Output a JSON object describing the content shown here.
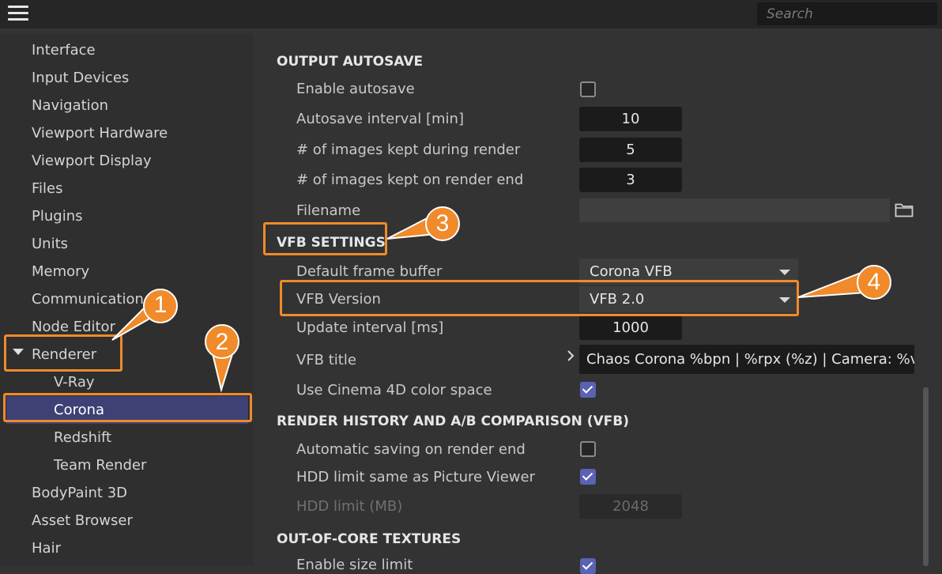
{
  "header": {
    "search_placeholder": "Search"
  },
  "sidebar": {
    "items": [
      {
        "label": "Interface"
      },
      {
        "label": "Input Devices"
      },
      {
        "label": "Navigation"
      },
      {
        "label": "Viewport Hardware"
      },
      {
        "label": "Viewport Display"
      },
      {
        "label": "Files"
      },
      {
        "label": "Plugins"
      },
      {
        "label": "Units"
      },
      {
        "label": "Memory"
      },
      {
        "label": "Communication"
      },
      {
        "label": "Node Editor"
      },
      {
        "label": "Renderer",
        "expanded": true
      },
      {
        "label": "V-Ray"
      },
      {
        "label": "Corona",
        "selected": true
      },
      {
        "label": "Redshift"
      },
      {
        "label": "Team Render"
      },
      {
        "label": "BodyPaint 3D"
      },
      {
        "label": "Asset Browser"
      },
      {
        "label": "Hair"
      }
    ]
  },
  "output_autosave": {
    "title": "OUTPUT AUTOSAVE",
    "enable_autosave_label": "Enable autosave",
    "enable_autosave_checked": false,
    "autosave_interval_label": "Autosave interval [min]",
    "autosave_interval_value": "10",
    "kept_during_label": "# of images kept during render",
    "kept_during_value": "5",
    "kept_end_label": "# of images kept on render end",
    "kept_end_value": "3",
    "filename_label": "Filename"
  },
  "vfb_settings": {
    "title": "VFB SETTINGS",
    "default_fb_label": "Default frame buffer",
    "default_fb_value": "Corona VFB",
    "vfb_version_label": "VFB Version",
    "vfb_version_value": "VFB 2.0",
    "update_interval_label": "Update interval [ms]",
    "update_interval_value": "1000",
    "vfb_title_label": "VFB title",
    "vfb_title_value": "Chaos Corona %bpn | %rpx (%z) | Camera: %v |",
    "cinema_color_label": "Use Cinema 4D color space",
    "cinema_color_checked": true
  },
  "render_history": {
    "title": "RENDER HISTORY AND A/B COMPARISON (VFB)",
    "auto_saving_label": "Automatic saving on render end",
    "auto_saving_checked": false,
    "hdd_same_label": "HDD limit same as Picture Viewer",
    "hdd_same_checked": true,
    "hdd_limit_label": "HDD limit (MB)",
    "hdd_limit_value": "2048"
  },
  "out_of_core": {
    "title": "OUT-OF-CORE TEXTURES",
    "enable_size_limit_label": "Enable size limit",
    "enable_size_limit_checked": true
  },
  "annotations": {
    "callout_1": "1",
    "callout_2": "2",
    "callout_3": "3",
    "callout_4": "4",
    "accent_color": "#f08a2a"
  },
  "colors": {
    "selection": "#3e4174",
    "checkbox_on": "#5a62b5",
    "panel_bg": "#333333",
    "sidebar_bg": "#2f2f2f",
    "topbar_bg": "#262626"
  }
}
